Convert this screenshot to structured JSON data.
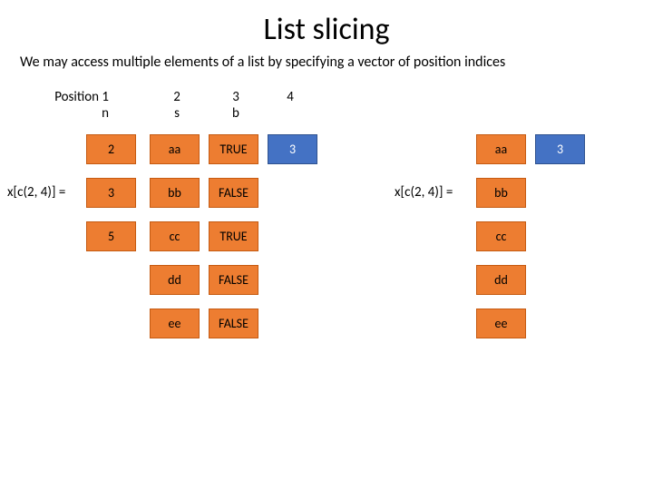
{
  "title": "List slicing",
  "subtitle": "We may access multiple elements of a list by specifying a vector of position indices",
  "positions": {
    "p1_label": "Position 1",
    "p2_label": "2",
    "p3_label": "3",
    "p4_label": "4",
    "name1": "n",
    "name2": "s",
    "name3": "b"
  },
  "left_expr": "x[c(2, 4)] =",
  "right_expr": "x[c(2, 4)] =",
  "col_n": [
    "2",
    "3",
    "5"
  ],
  "col_s": [
    "aa",
    "bb",
    "cc",
    "dd",
    "ee"
  ],
  "col_b": [
    "TRUE",
    "FALSE",
    "TRUE",
    "FALSE",
    "FALSE"
  ],
  "highlight_row0": "3",
  "right_col": [
    "aa",
    "bb",
    "cc",
    "dd",
    "ee"
  ],
  "right_highlight": "3"
}
